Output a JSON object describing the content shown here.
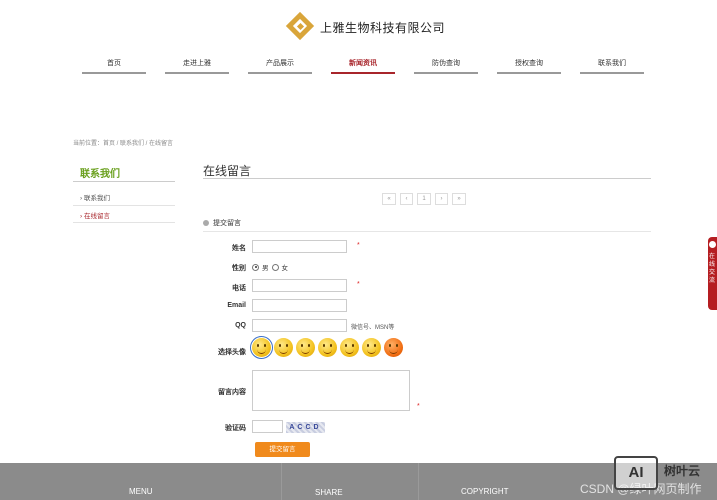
{
  "header": {
    "company_name": "上雅生物科技有限公司"
  },
  "nav": {
    "items": [
      {
        "label": "首页"
      },
      {
        "label": "走进上雅"
      },
      {
        "label": "产品展示"
      },
      {
        "label": "新闻资讯",
        "active": true
      },
      {
        "label": "防伪查询"
      },
      {
        "label": "授权查询"
      },
      {
        "label": "联系我们"
      }
    ]
  },
  "breadcrumb": "当前位置：首页 / 联系我们 / 在线留言",
  "sidebar": {
    "title": "联系我们",
    "items": [
      {
        "label": "联系我们"
      },
      {
        "label": "在线留言",
        "active": true
      }
    ]
  },
  "main": {
    "title": "在线留言",
    "pager": [
      "«",
      "‹",
      "1",
      "›",
      "»"
    ],
    "section_title": "提交留言"
  },
  "form": {
    "name_label": "姓名",
    "gender_label": "性别",
    "gender_male": "男",
    "gender_female": "女",
    "phone_label": "电话",
    "email_label": "Email",
    "qq_label": "QQ",
    "qq_hint": "微信号、MSN等",
    "avatar_label": "选择头像",
    "content_label": "留言内容",
    "captcha_label": "验证码",
    "captcha_text": "ACCD",
    "required_mark": "*",
    "submit_label": "提交留言"
  },
  "float_tab": {
    "text": "在线交流"
  },
  "footer": {
    "menu": "MENU",
    "share": "SHARE",
    "copyright": "COPYRIGHT"
  },
  "watermark": {
    "logo": "AI",
    "name": "树叶云",
    "csdn": "CSDN @绿叶网页制作"
  },
  "colors": {
    "accent_red": "#a8252b",
    "sidebar_green": "#6aa01e",
    "button_orange": "#f08a1c",
    "footer_gray": "#8b8b8b"
  }
}
